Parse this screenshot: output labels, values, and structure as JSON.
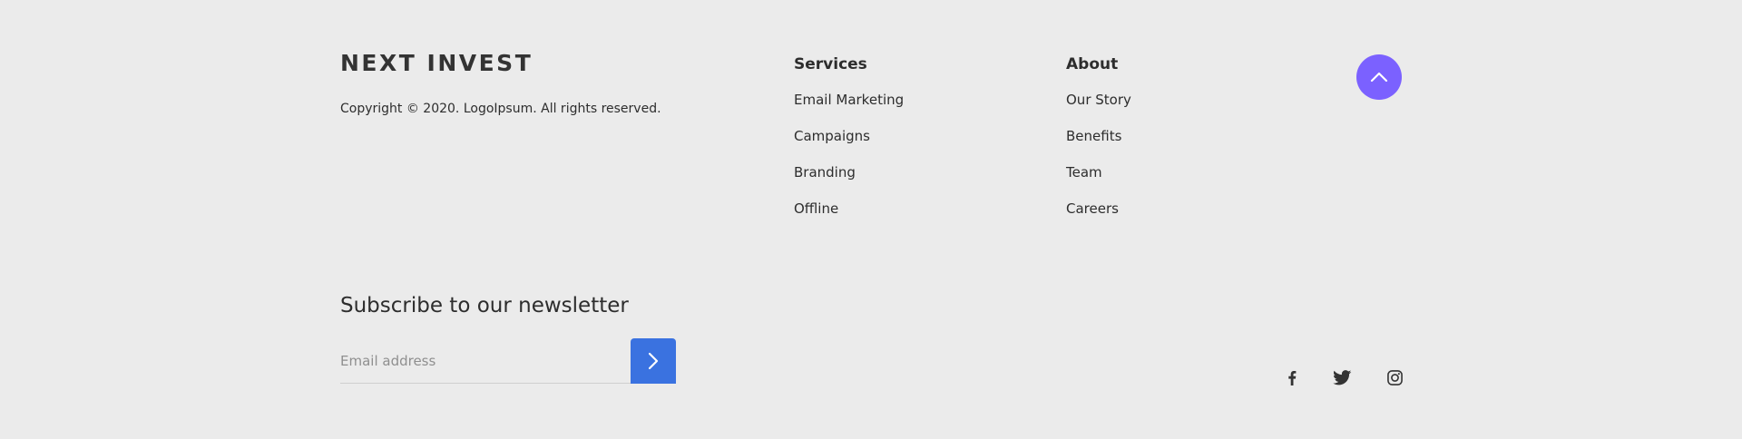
{
  "brand": {
    "name": "NEXT INVEST",
    "copyright": "Copyright © 2020. LogoIpsum. All rights reserved."
  },
  "services": {
    "heading": "Services",
    "links": [
      "Email Marketing",
      "Campaigns",
      "Branding",
      "Offline"
    ]
  },
  "about": {
    "heading": "About",
    "links": [
      "Our Story",
      "Benefits",
      "Team",
      "Careers"
    ]
  },
  "newsletter": {
    "title": "Subscribe to our newsletter",
    "email_placeholder": "Email address",
    "email_value": ""
  },
  "icons": {
    "scroll_top": "chevron-up-icon",
    "submit": "chevron-right-icon",
    "social": [
      "facebook-icon",
      "twitter-icon",
      "instagram-icon"
    ]
  },
  "colors": {
    "background": "#ebebeb",
    "text": "#2d2d2d",
    "scroll_top_button": "#7b61ff",
    "submit_button": "#3a72e0"
  }
}
